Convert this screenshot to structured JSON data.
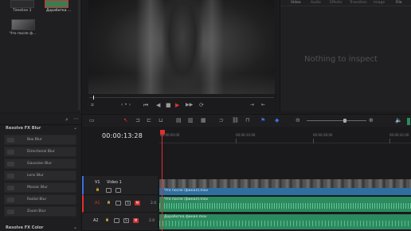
{
  "media_pool": {
    "clips": [
      {
        "label": "Timeline 1"
      },
      {
        "label": "Доработка ..."
      },
      {
        "label": "Что после ф..."
      }
    ]
  },
  "viewer": {
    "transport": {
      "first": "⏮",
      "prev": "◀◀",
      "reverse": "◀",
      "stop": "■",
      "play": "▶",
      "next": "▶▶",
      "loop": "⟳"
    }
  },
  "inspector": {
    "tabs": [
      "Video",
      "Audio",
      "Effects",
      "Transition",
      "Image",
      "File"
    ],
    "empty_message": "Nothing to inspect"
  },
  "effects": {
    "section_blur": "Resolve FX Blur",
    "items": [
      {
        "label": "Box Blur"
      },
      {
        "label": "Directional Blur"
      },
      {
        "label": "Gaussian Blur"
      },
      {
        "label": "Lens Blur"
      },
      {
        "label": "Mosaic Blur"
      },
      {
        "label": "Radial Blur"
      },
      {
        "label": "Zoom Blur"
      }
    ],
    "section_color": "Resolve FX Color"
  },
  "timeline": {
    "timecode": "00:00:13:28",
    "ruler_ticks": [
      "00:00:00:00",
      "00:00:14:00",
      "00:00:28:00",
      "00:00:42:00"
    ],
    "tracks": {
      "v1": {
        "name": "V1",
        "title": "Video 1"
      },
      "a1": {
        "name": "A1",
        "volume": "2.0"
      },
      "a2": {
        "name": "A2",
        "volume": "2.0"
      }
    },
    "clips": {
      "v1_top": "Что после (финал).mov",
      "a1": "Что после (финал).mov",
      "a2": "Доработка финал.mov"
    }
  },
  "colors": {
    "accent_red": "#e0302e",
    "video_clip_blue": "#2f6fa0",
    "audio_clip_green": "#2b8a5e",
    "audio_wave": "#7fe0b0"
  }
}
